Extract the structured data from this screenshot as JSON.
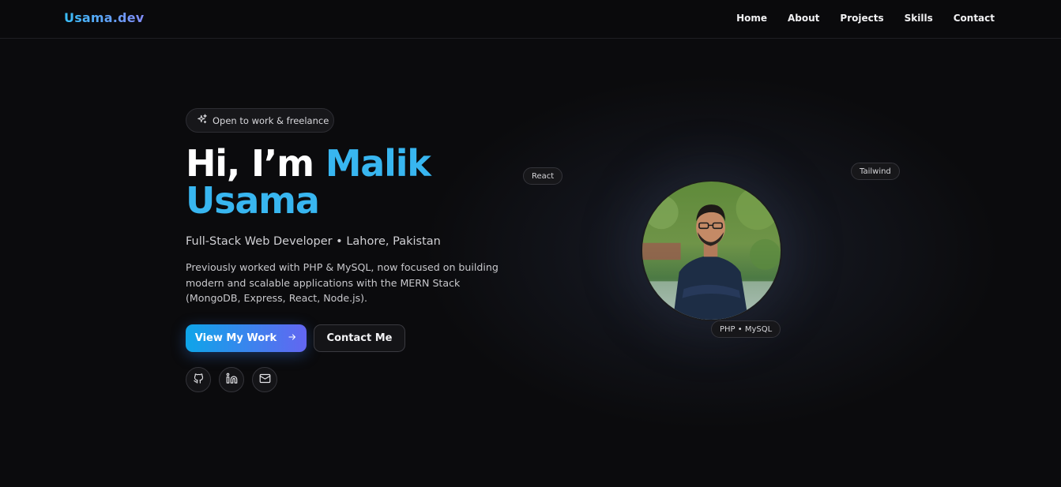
{
  "nav": {
    "logo": "Usama.dev",
    "links": [
      "Home",
      "About",
      "Projects",
      "Skills",
      "Contact"
    ]
  },
  "hero": {
    "badge": "Open to work & freelance",
    "title_prefix": "Hi, I’m",
    "title_name_1": "Malik",
    "title_name_2": "Usama",
    "subtitle": "Full-Stack Web Developer • Lahore, Pakistan",
    "description": "Previously worked with PHP & MySQL, now focused on building modern and scalable applications with the MERN Stack (MongoDB, Express, React, Node.js).",
    "primary_button": "View My Work",
    "secondary_button": "Contact Me",
    "socials": [
      "github-icon",
      "linkedin-icon",
      "mail-icon"
    ]
  },
  "tags": {
    "react": "React",
    "tailwind": "Tailwind",
    "php": "PHP • MySQL"
  },
  "colors": {
    "accent": "#38b6f0",
    "gradient_start": "#0ea5e9",
    "gradient_end": "#6366f1",
    "background": "#0b0b0d"
  }
}
